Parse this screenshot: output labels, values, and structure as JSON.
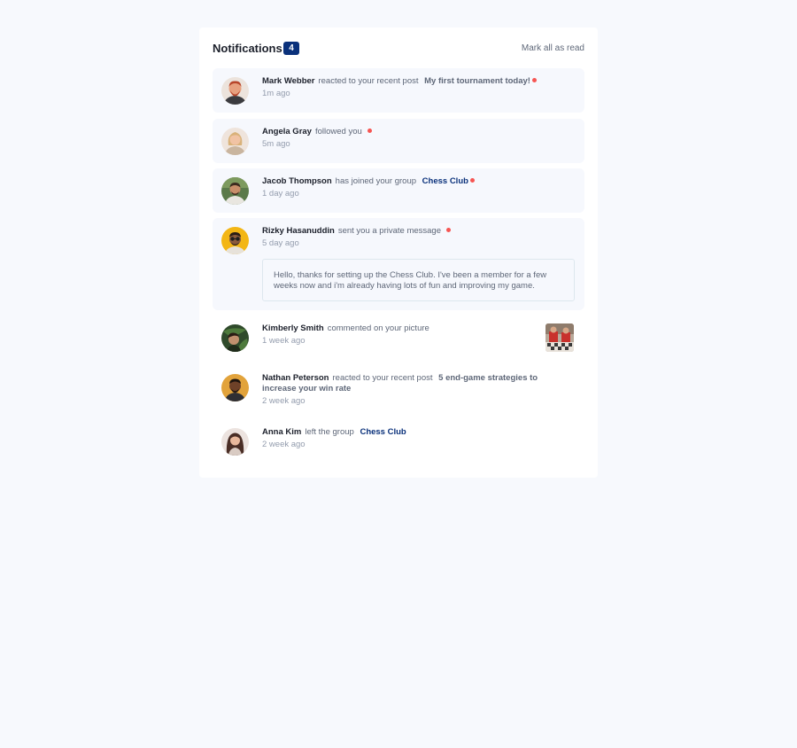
{
  "header": {
    "title": "Notifications",
    "unread_count": "4",
    "mark_all_label": "Mark all as read"
  },
  "notifications": [
    {
      "actor": "Mark Webber",
      "action": "reacted to your recent post",
      "target": "My first tournament today!",
      "time": "1m ago",
      "unread": true,
      "avatar": "avatar-mark-webber"
    },
    {
      "actor": "Angela Gray",
      "action": "followed you",
      "target": "",
      "time": "5m ago",
      "unread": true,
      "avatar": "avatar-angela-gray"
    },
    {
      "actor": "Jacob Thompson",
      "action": "has joined your group",
      "target": "Chess Club",
      "time": "1 day ago",
      "unread": true,
      "avatar": "avatar-jacob-thompson"
    },
    {
      "actor": "Rizky Hasanuddin",
      "action": "sent you a private message",
      "target": "",
      "time": "5 day ago",
      "unread": true,
      "message": "Hello, thanks for setting up the Chess Club. I've been a member for a few weeks now and i'm already having lots of fun and improving my game.",
      "avatar": "avatar-rizky-hasanuddin"
    },
    {
      "actor": "Kimberly Smith",
      "action": "commented on your picture",
      "target": "",
      "time": "1 week ago",
      "unread": false,
      "avatar": "avatar-kimberly-smith",
      "thumbnail": "chess-picture-thumbnail"
    },
    {
      "actor": "Nathan Peterson",
      "action": "reacted to your recent post",
      "target": "5 end-game strategies to increase your win rate",
      "time": "2 week ago",
      "unread": false,
      "avatar": "avatar-nathan-peterson"
    },
    {
      "actor": "Anna Kim",
      "action": "left the group",
      "target": "Chess Club",
      "time": "2 week ago",
      "unread": false,
      "avatar": "avatar-anna-kim"
    }
  ],
  "colors": {
    "page_bg": "#f7f9fd",
    "unread_bg": "#f6f8fd",
    "badge": "#0a317b",
    "dot": "#f65552",
    "group_link": "#0a317b"
  }
}
